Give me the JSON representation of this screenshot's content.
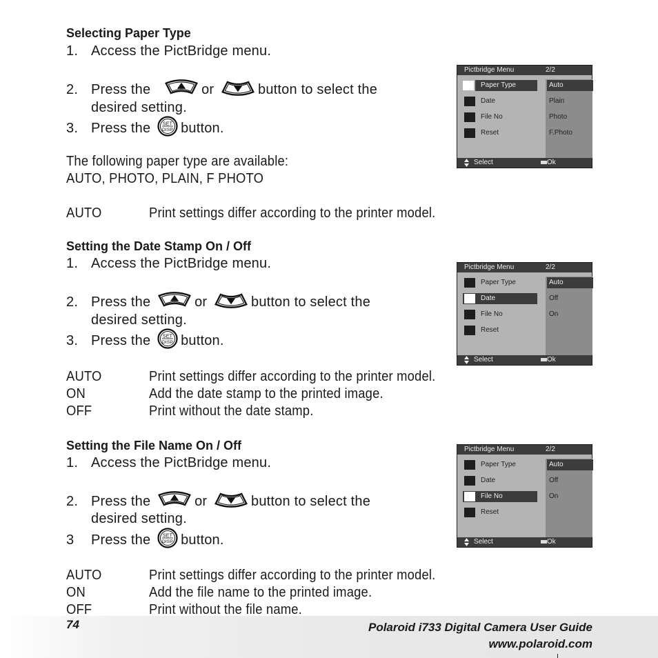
{
  "sections": [
    {
      "heading": "Selecting Paper Type",
      "steps": [
        {
          "num": "1.",
          "text": "Access the PictBridge menu."
        },
        {
          "num": "2.",
          "pre": "Press the",
          "mid": "or",
          "post": "button to select the",
          "cont": "desired setting."
        },
        {
          "num": "3.",
          "pre": "Press the",
          "post": "button."
        }
      ],
      "note_lines": [
        "The following paper type are available:",
        "AUTO, PHOTO, PLAIN, F PHOTO"
      ],
      "definitions": [
        {
          "term": "AUTO",
          "desc": "Print settings differ according to the printer model."
        }
      ],
      "screen": {
        "title": "Pictbridge Menu",
        "page": "2/2",
        "items": [
          {
            "label": "Paper Type",
            "icon": "paper-type-icon"
          },
          {
            "label": "Date",
            "icon": "clock-icon"
          },
          {
            "label": "File No",
            "icon": "file-number-icon"
          },
          {
            "label": "Reset",
            "icon": "reset-icon"
          }
        ],
        "selected_item": "Paper Type",
        "options": [
          "Auto",
          "Plain",
          "Photo",
          "F.Photo"
        ],
        "selected_option": "Auto",
        "footer_left": "Select",
        "footer_right": "Ok"
      }
    },
    {
      "heading": "Setting the Date Stamp On / Off",
      "steps": [
        {
          "num": "1.",
          "text": "Access the PictBridge menu."
        },
        {
          "num": "2.",
          "pre": "Press the",
          "mid": "or",
          "post": "button to select the",
          "cont": "desired setting."
        },
        {
          "num": "3.",
          "pre": "Press the",
          "post": "button."
        }
      ],
      "definitions": [
        {
          "term": "AUTO",
          "desc": "Print settings differ according to the printer model."
        },
        {
          "term": "ON",
          "desc": "Add the date stamp to the printed image."
        },
        {
          "term": "OFF",
          "desc": "Print without the date stamp."
        }
      ],
      "screen": {
        "title": "Pictbridge Menu",
        "page": "2/2",
        "items": [
          {
            "label": "Paper Type",
            "icon": "paper-type-icon"
          },
          {
            "label": "Date",
            "icon": "clock-icon"
          },
          {
            "label": "File No",
            "icon": "file-number-icon"
          },
          {
            "label": "Reset",
            "icon": "reset-icon"
          }
        ],
        "selected_item": "Date",
        "options": [
          "Auto",
          "Off",
          "On"
        ],
        "selected_option": "Auto",
        "footer_left": "Select",
        "footer_right": "Ok"
      }
    },
    {
      "heading": "Setting the File Name On / Off",
      "steps": [
        {
          "num": "1.",
          "text": "Access the PictBridge menu."
        },
        {
          "num": "2.",
          "pre": "Press the",
          "mid": "or",
          "post": "button to select the",
          "cont": "desired setting."
        },
        {
          "num": "3",
          "pre": "Press the",
          "post": "button."
        }
      ],
      "definitions": [
        {
          "term": "AUTO",
          "desc": "Print settings differ according to the printer model."
        },
        {
          "term": "ON",
          "desc": "Add the file name to the printed image."
        },
        {
          "term": "OFF",
          "desc": "Print without the file name."
        }
      ],
      "screen": {
        "title": "Pictbridge Menu",
        "page": "2/2",
        "items": [
          {
            "label": "Paper Type",
            "icon": "paper-type-icon"
          },
          {
            "label": "Date",
            "icon": "clock-icon"
          },
          {
            "label": "File No",
            "icon": "file-number-icon"
          },
          {
            "label": "Reset",
            "icon": "reset-icon"
          }
        ],
        "selected_item": "File No",
        "options": [
          "Auto",
          "Off",
          "On"
        ],
        "selected_option": "Auto",
        "footer_left": "Select",
        "footer_right": "Ok"
      }
    }
  ],
  "buttons": {
    "up": "up-arrow-button-icon",
    "down": "down-arrow-button-icon",
    "set_disp": "SET DISP",
    "set": "SET",
    "disp": "DISP"
  },
  "footer": {
    "page_number": "74",
    "guide_title": "Polaroid i733 Digital Camera User Guide",
    "url": "www.polaroid.com"
  },
  "colors": {
    "lcd_dark": "#3c3c3c",
    "lcd_light": "#b4b4b4",
    "lcd_option_col": "#8c8c8c",
    "footer_band": "#e8e8e8"
  }
}
